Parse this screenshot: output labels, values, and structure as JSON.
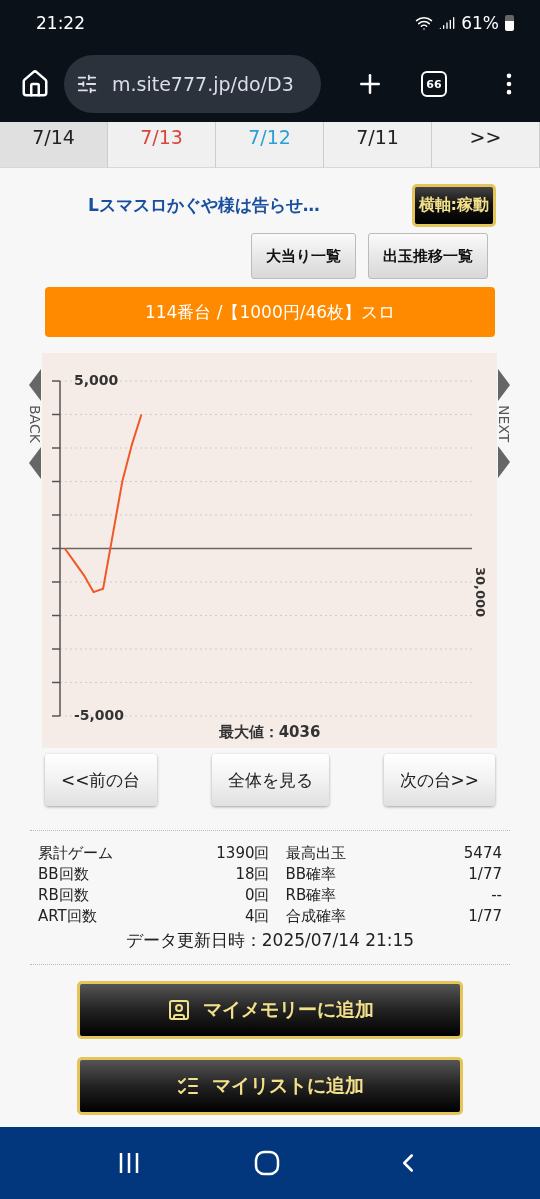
{
  "status_bar": {
    "time": "21:22",
    "battery": "61%"
  },
  "browser": {
    "url": "m.site777.jp/do/D3",
    "tab_count": "66"
  },
  "date_tabs": [
    {
      "label": "7/14",
      "selected": true,
      "color": "#222222"
    },
    {
      "label": "7/13",
      "selected": false,
      "color": "#d9453a"
    },
    {
      "label": "7/12",
      "selected": false,
      "color": "#2a9fd8"
    },
    {
      "label": "7/11",
      "selected": false,
      "color": "#222222"
    },
    {
      "label": ">>",
      "selected": false,
      "color": "#222222"
    }
  ],
  "store_link": "Lスマスロかぐや様は告らせ…",
  "axis_toggle": "横軸:稼動",
  "list_buttons": [
    "大当り一覧",
    "出玉推移一覧"
  ],
  "machine_title": "114番台 /【1000円/46枚】スロ",
  "chart_nav": {
    "back": "BACK",
    "next": "NEXT"
  },
  "chart": {
    "chart_data": {
      "type": "line",
      "ylim": [
        -5000,
        5000
      ],
      "categories": [
        null,
        null,
        null,
        null,
        null,
        null,
        null,
        null,
        null,
        null,
        null,
        null,
        null,
        null,
        null,
        null,
        null,
        null,
        null,
        null,
        null,
        null,
        null,
        null,
        null,
        null,
        null,
        null,
        null,
        null,
        null,
        null,
        null,
        null,
        null,
        null,
        null,
        null,
        null,
        null,
        null,
        null,
        null
      ],
      "annotations": [
        {
          "text": "30,000"
        }
      ],
      "yticks": [
        {
          "value": 5000,
          "label": "5,000"
        },
        {
          "value": -5000,
          "label": "-5,000"
        }
      ],
      "series": [
        {
          "color": "#f0582a",
          "values": [
            0,
            -400,
            -800,
            -1300,
            -1200,
            400,
            2000,
            3100,
            4000,
            null,
            null,
            null,
            null,
            null,
            null,
            null,
            null,
            null,
            null,
            null,
            null,
            null,
            null,
            null,
            null,
            null,
            null,
            null,
            null,
            null,
            null,
            null,
            null,
            null,
            null,
            null,
            null,
            null,
            null,
            null,
            null,
            null,
            null
          ]
        }
      ]
    },
    "max_text": "最大値：4036"
  },
  "nav_buttons": [
    "<<前の台",
    "全体を見る",
    "次の台>>"
  ],
  "stats": [
    [
      "累計ゲーム",
      "1390回",
      "最高出玉",
      "5474"
    ],
    [
      "BB回数",
      "18回",
      "BB確率",
      "1/77"
    ],
    [
      "RB回数",
      "0回",
      "RB確率",
      "--"
    ],
    [
      "ART回数",
      "4回",
      "合成確率",
      "1/77"
    ]
  ],
  "updated": "データ更新日時：2025/07/14 21:15",
  "gold_buttons": [
    {
      "kind": "memory",
      "label": "マイメモリーに追加"
    },
    {
      "kind": "list",
      "label": "マイリストに追加"
    }
  ]
}
